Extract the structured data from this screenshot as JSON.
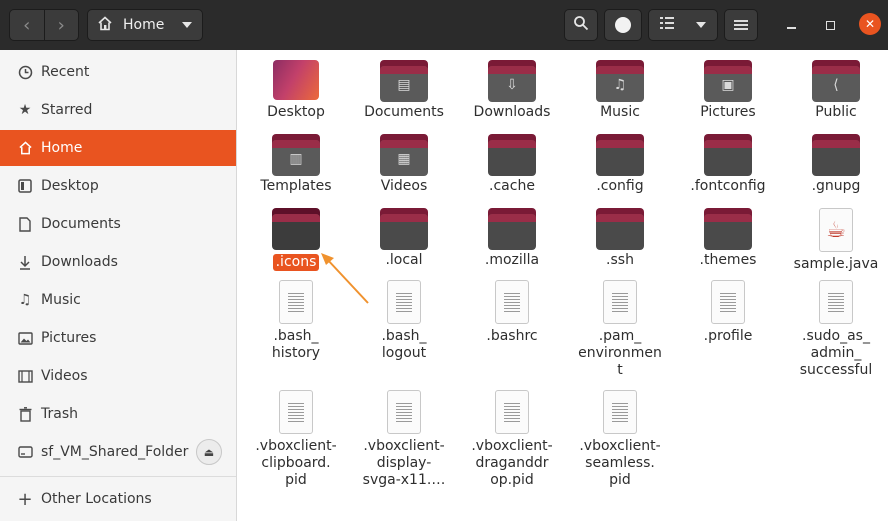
{
  "header": {
    "path_label": "Home",
    "back_icon": "‹",
    "forward_icon": "›"
  },
  "sidebar": {
    "items": [
      {
        "label": "Recent",
        "icon": "clock-icon"
      },
      {
        "label": "Starred",
        "icon": "star-icon"
      },
      {
        "label": "Home",
        "icon": "home-icon"
      },
      {
        "label": "Desktop",
        "icon": "desktop-icon"
      },
      {
        "label": "Documents",
        "icon": "documents-icon"
      },
      {
        "label": "Downloads",
        "icon": "downloads-icon"
      },
      {
        "label": "Music",
        "icon": "music-icon"
      },
      {
        "label": "Pictures",
        "icon": "pictures-icon"
      },
      {
        "label": "Videos",
        "icon": "videos-icon"
      },
      {
        "label": "Trash",
        "icon": "trash-icon"
      },
      {
        "label": "sf_VM_Shared_Folder",
        "icon": "drive-icon"
      },
      {
        "label": "Other Locations",
        "icon": "plus-icon"
      }
    ],
    "active": "Home"
  },
  "files": [
    {
      "label": "Desktop",
      "kind": "desktop"
    },
    {
      "label": "Documents",
      "kind": "folder",
      "symbol": "document"
    },
    {
      "label": "Downloads",
      "kind": "folder",
      "symbol": "download"
    },
    {
      "label": "Music",
      "kind": "folder",
      "symbol": "music"
    },
    {
      "label": "Pictures",
      "kind": "folder",
      "symbol": "picture"
    },
    {
      "label": "Public",
      "kind": "folder",
      "symbol": "share"
    },
    {
      "label": "Templates",
      "kind": "folder",
      "symbol": "template"
    },
    {
      "label": "Videos",
      "kind": "folder",
      "symbol": "film"
    },
    {
      "label": ".cache",
      "kind": "folder"
    },
    {
      "label": ".config",
      "kind": "folder"
    },
    {
      "label": ".fontconfig",
      "kind": "folder"
    },
    {
      "label": ".gnupg",
      "kind": "folder"
    },
    {
      "label": ".icons",
      "kind": "folder",
      "selected": true
    },
    {
      "label": ".local",
      "kind": "folder"
    },
    {
      "label": ".mozilla",
      "kind": "folder"
    },
    {
      "label": ".ssh",
      "kind": "folder"
    },
    {
      "label": ".themes",
      "kind": "folder"
    },
    {
      "label": "sample.java",
      "kind": "java"
    },
    {
      "label": ".bash_\nhistory",
      "kind": "text"
    },
    {
      "label": ".bash_\nlogout",
      "kind": "text"
    },
    {
      "label": ".bashrc",
      "kind": "text"
    },
    {
      "label": ".pam_\nenvironmen\nt",
      "kind": "text"
    },
    {
      "label": ".profile",
      "kind": "text"
    },
    {
      "label": ".sudo_as_\nadmin_\nsuccessful",
      "kind": "text"
    },
    {
      "label": ".vboxclient-\nclipboard.\npid",
      "kind": "text"
    },
    {
      "label": ".vboxclient-\ndisplay-\nsvga-x11.…",
      "kind": "text"
    },
    {
      "label": ".vboxclient-\ndraganddr\nop.pid",
      "kind": "text"
    },
    {
      "label": ".vboxclient-\nseamless.\npid",
      "kind": "text"
    }
  ],
  "colors": {
    "accent": "#e95420",
    "headerbar": "#2b2b2b",
    "sidebar_bg": "#f5f5f5",
    "arrow": "#f0922e"
  }
}
